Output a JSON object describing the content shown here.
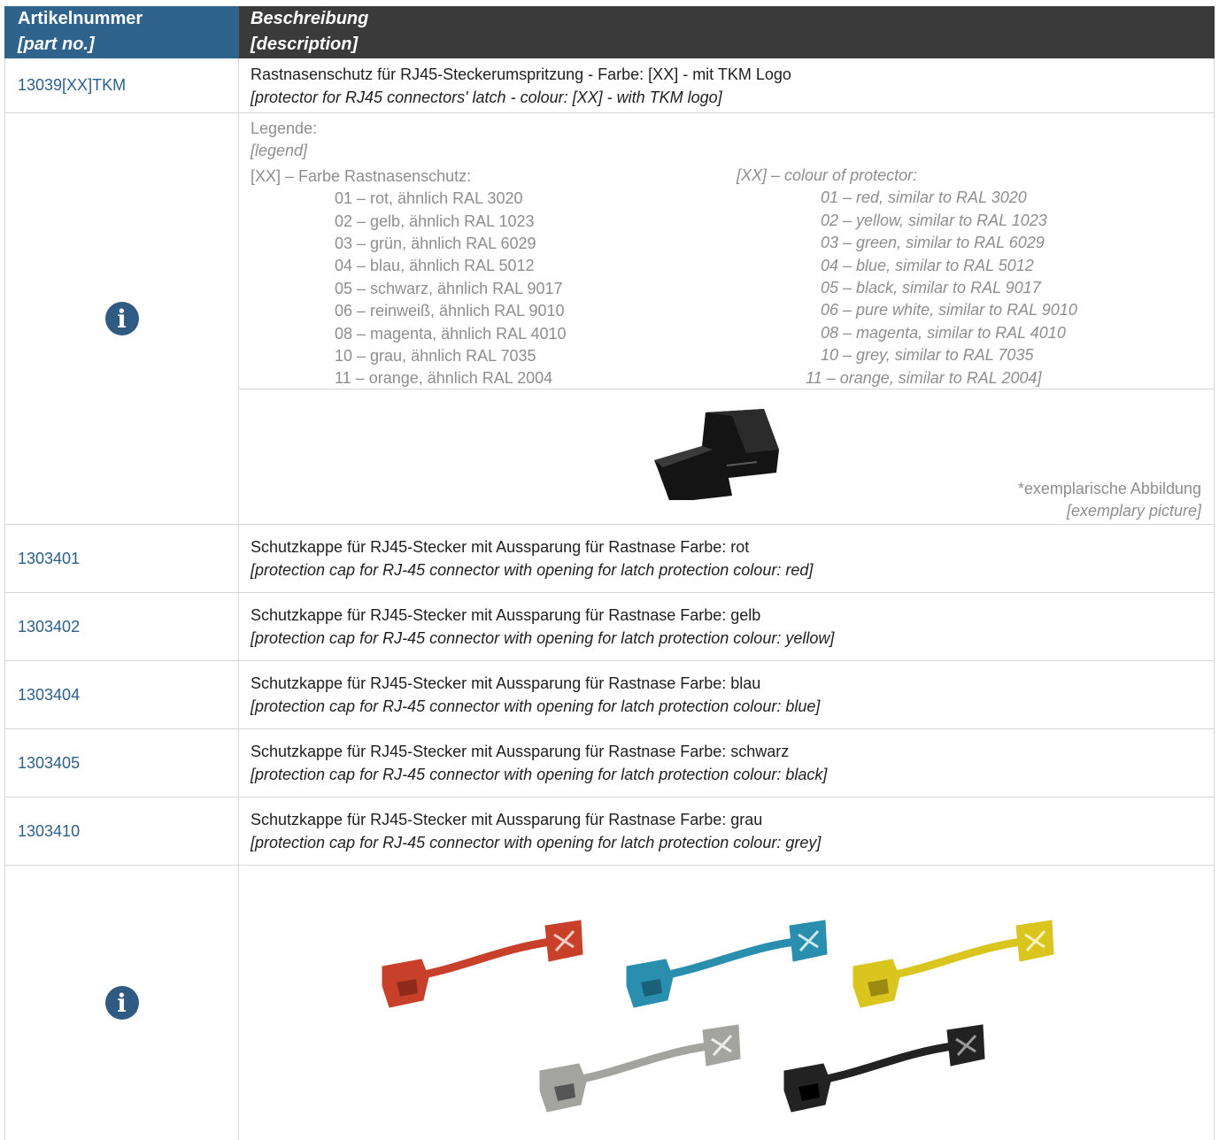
{
  "header": {
    "col1_de": "Artikelnummer",
    "col1_en": "[part no.]",
    "col2_de": "Beschreibung",
    "col2_en": "[description]"
  },
  "first_item": {
    "part_no": "13039[XX]TKM",
    "desc_de": "Rastnasenschutz für RJ45-Steckerumspritzung - Farbe: [XX] - mit TKM Logo",
    "desc_en": "[protector for RJ45 connectors' latch - colour: [XX] - with TKM logo]"
  },
  "legend": {
    "title_de": "Legende:",
    "title_en": "[legend]",
    "heading_de": "[XX] – Farbe Rastnasenschutz:",
    "heading_en": "[XX] – colour of protector:",
    "items_de": [
      "01 – rot, ähnlich RAL 3020",
      "02 – gelb, ähnlich RAL 1023",
      "03 – grün, ähnlich RAL 6029",
      "04 – blau, ähnlich RAL 5012",
      "05 – schwarz, ähnlich RAL 9017",
      "06 – reinweiß, ähnlich RAL 9010",
      "08 – magenta, ähnlich RAL 4010",
      "10 – grau, ähnlich RAL 7035",
      "11 – orange, ähnlich RAL 2004"
    ],
    "items_en": [
      "01 – red, similar to RAL 3020",
      "02 – yellow, similar to RAL 1023",
      "03 – green, similar to RAL 6029",
      "04 – blue, similar to RAL 5012",
      "05 – black, similar to RAL 9017",
      "06 – pure white, similar to RAL 9010",
      "08 – magenta, similar to RAL 4010",
      "10 – grey, similar to RAL 7035",
      "11 – orange, similar to RAL 2004]"
    ]
  },
  "caption": {
    "de": "*exemplarische Abbildung",
    "en": "[exemplary picture]"
  },
  "products": [
    {
      "part_no": "1303401",
      "desc_de": "Schutzkappe für RJ45-Stecker mit Aussparung für Rastnase Farbe: rot",
      "desc_en": "[protection cap for RJ-45 connector with opening for latch protection colour: red]"
    },
    {
      "part_no": "1303402",
      "desc_de": "Schutzkappe für RJ45-Stecker mit Aussparung für Rastnase Farbe: gelb",
      "desc_en": "[protection cap for RJ-45 connector with opening for latch protection colour: yellow]"
    },
    {
      "part_no": "1303404",
      "desc_de": "Schutzkappe für RJ45-Stecker mit Aussparung für Rastnase Farbe: blau",
      "desc_en": "[protection cap for RJ-45 connector with opening for latch protection colour: blue]"
    },
    {
      "part_no": "1303405",
      "desc_de": "Schutzkappe für RJ45-Stecker mit Aussparung für Rastnase Farbe: schwarz",
      "desc_en": "[protection cap for RJ-45 connector with opening for latch protection colour: black]"
    },
    {
      "part_no": "1303410",
      "desc_de": "Schutzkappe für RJ45-Stecker mit Aussparung für Rastnase Farbe: grau",
      "desc_en": "[protection cap for RJ-45 connector with opening for latch protection colour: grey]"
    }
  ],
  "colors": {
    "header_blue": "#2f638c",
    "header_dark": "#3a3a3a",
    "part_link": "#2c5f8a",
    "cap_red": "#c8402a",
    "cap_blue": "#2a8fae",
    "cap_yellow": "#d9c51e",
    "cap_grey": "#a3a3a0",
    "cap_black": "#222222"
  },
  "icons": [
    "info-icon",
    "latch-protector-image",
    "protection-caps-image"
  ]
}
